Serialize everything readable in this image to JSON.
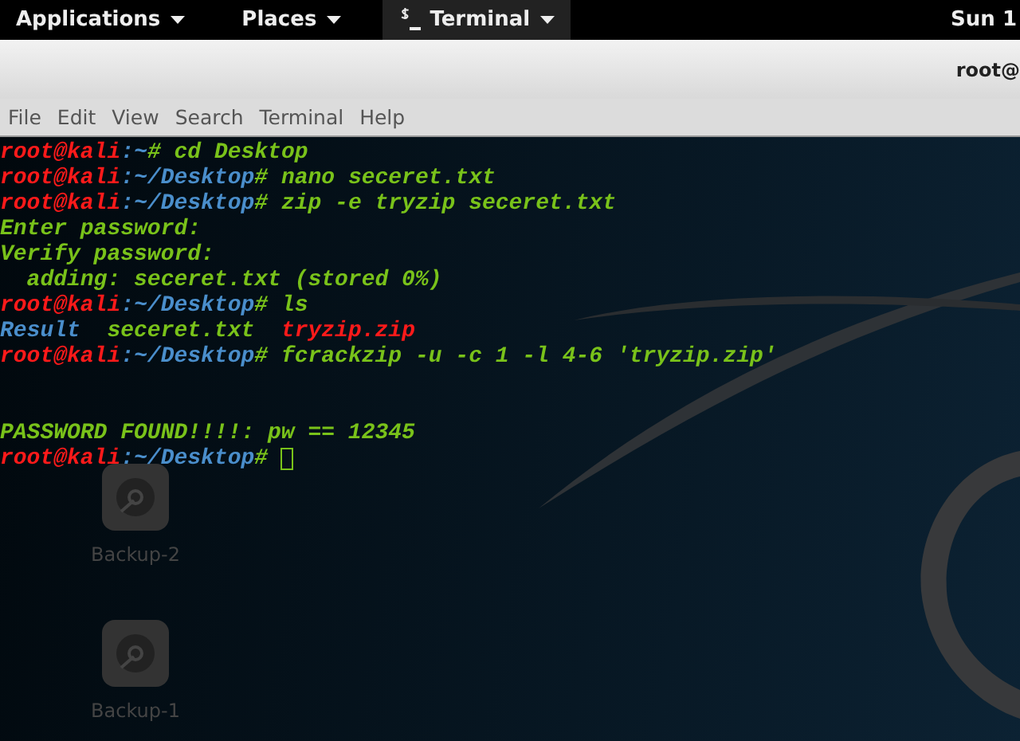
{
  "top_bar": {
    "menus": [
      {
        "label": "Applications",
        "selected": false,
        "kind": "menu"
      },
      {
        "label": "Places",
        "selected": false,
        "kind": "menu"
      },
      {
        "label": "Terminal",
        "selected": true,
        "kind": "app"
      }
    ],
    "clock": "Sun 1"
  },
  "window": {
    "title": "root@"
  },
  "menu_bar": [
    "File",
    "Edit",
    "View",
    "Search",
    "Terminal",
    "Help"
  ],
  "terminal": {
    "cursor": true,
    "lines": [
      {
        "kind": "text",
        "segments": [
          {
            "kind": "user",
            "text": "root@kali"
          },
          {
            "kind": "path",
            "text": ":~"
          },
          {
            "kind": "command",
            "text": "# cd Desktop"
          }
        ]
      },
      {
        "kind": "text",
        "segments": [
          {
            "kind": "user",
            "text": "root@kali"
          },
          {
            "kind": "path",
            "text": ":~/Desktop"
          },
          {
            "kind": "command",
            "text": "# nano seceret.txt"
          }
        ]
      },
      {
        "kind": "text",
        "segments": [
          {
            "kind": "user",
            "text": "root@kali"
          },
          {
            "kind": "path",
            "text": ":~/Desktop"
          },
          {
            "kind": "command",
            "text": "# zip -e tryzip seceret.txt"
          }
        ]
      },
      {
        "kind": "text",
        "segments": [
          {
            "kind": "output",
            "text": "Enter password:"
          }
        ]
      },
      {
        "kind": "text",
        "segments": [
          {
            "kind": "output",
            "text": "Verify password:"
          }
        ]
      },
      {
        "kind": "text",
        "segments": [
          {
            "kind": "output",
            "text": "  adding: seceret.txt (stored 0%)"
          }
        ]
      },
      {
        "kind": "text",
        "segments": [
          {
            "kind": "user",
            "text": "root@kali"
          },
          {
            "kind": "path",
            "text": ":~/Desktop"
          },
          {
            "kind": "command",
            "text": "# ls"
          }
        ]
      },
      {
        "kind": "text",
        "segments": [
          {
            "kind": "directory",
            "text": "Result"
          },
          {
            "kind": "output",
            "text": "  seceret.txt  "
          },
          {
            "kind": "archive",
            "text": "tryzip.zip"
          }
        ]
      },
      {
        "kind": "text",
        "segments": [
          {
            "kind": "user",
            "text": "root@kali"
          },
          {
            "kind": "path",
            "text": ":~/Desktop"
          },
          {
            "kind": "command",
            "text": "# fcrackzip -u -c 1 -l 4-6 'tryzip.zip'"
          }
        ]
      },
      {
        "kind": "blank"
      },
      {
        "kind": "blank"
      },
      {
        "kind": "text",
        "segments": [
          {
            "kind": "output",
            "text": "PASSWORD FOUND!!!!: pw == 12345"
          }
        ]
      },
      {
        "kind": "text",
        "segments": [
          {
            "kind": "user",
            "text": "root@kali"
          },
          {
            "kind": "path",
            "text": ":~/Desktop"
          },
          {
            "kind": "command",
            "text": "# "
          }
        ]
      }
    ]
  },
  "desktop_icons": [
    {
      "label": "Backup-2"
    },
    {
      "label": "Backup-1"
    }
  ]
}
